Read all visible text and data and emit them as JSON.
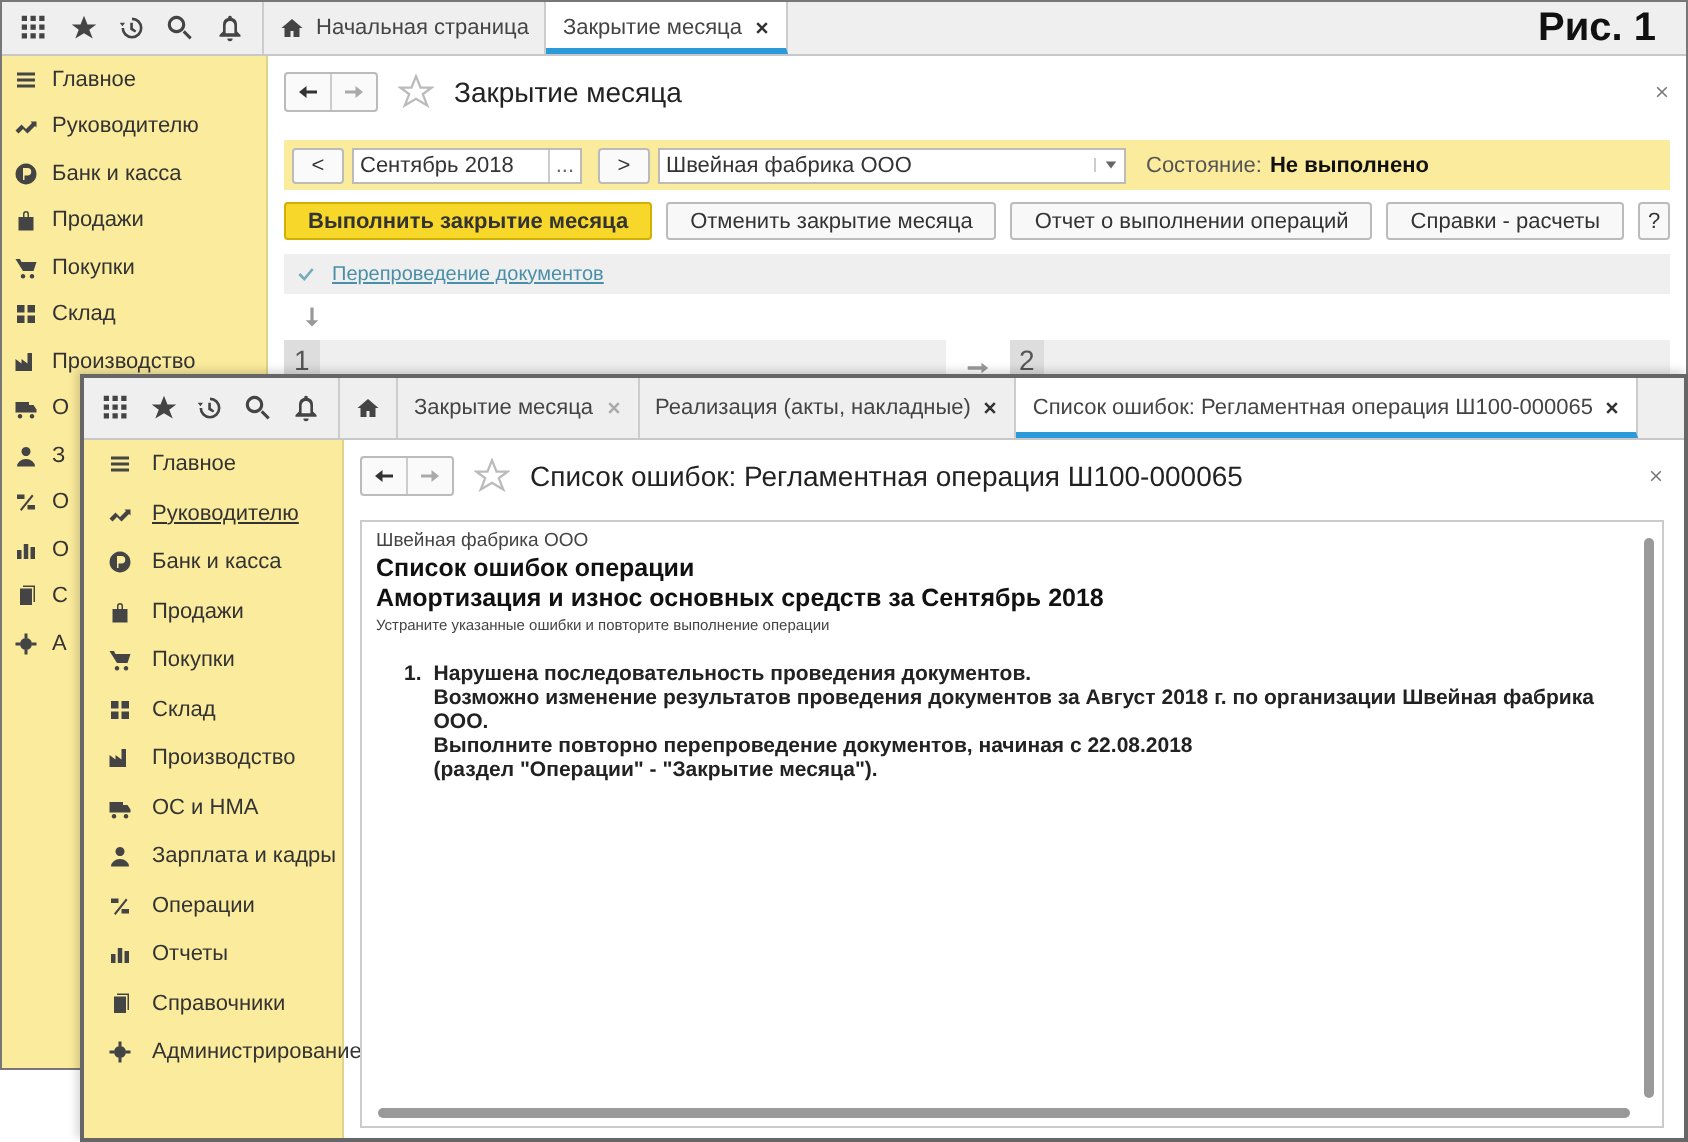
{
  "figure_label": "Рис. 1",
  "back_window": {
    "tabs": [
      {
        "label": "Начальная страница",
        "kind": "home",
        "selected": false
      },
      {
        "label": "Закрытие месяца",
        "kind": "page",
        "selected": true
      }
    ],
    "sidebar": {
      "items": [
        {
          "label": "Главное"
        },
        {
          "label": "Руководителю"
        },
        {
          "label": "Банк и касса"
        },
        {
          "label": "Продажи"
        },
        {
          "label": "Покупки"
        },
        {
          "label": "Склад"
        },
        {
          "label": "Производство"
        },
        {
          "label": "О"
        },
        {
          "label": "З"
        },
        {
          "label": "О"
        },
        {
          "label": "О"
        },
        {
          "label": "С"
        },
        {
          "label": "А"
        }
      ]
    },
    "title": "Закрытие месяца",
    "period": {
      "prev": "<",
      "value": "Сентябрь 2018",
      "picker": "...",
      "next": ">"
    },
    "organization": {
      "value": "Швейная фабрика ООО"
    },
    "status": {
      "label": "Состояние:",
      "value": "Не выполнено"
    },
    "buttons": [
      {
        "label": "Выполнить закрытие месяца",
        "kind": "primary"
      },
      {
        "label": "Отменить закрытие месяца",
        "kind": "normal"
      },
      {
        "label": "Отчет о выполнении операций",
        "kind": "normal"
      },
      {
        "label": "Справки - расчеты",
        "kind": "normal"
      },
      {
        "label": "?",
        "kind": "help"
      }
    ],
    "step_link": {
      "label": "Перепроведение документов",
      "done": true
    },
    "steps": [
      "1",
      "2"
    ]
  },
  "front_window": {
    "tabs": [
      {
        "kind": "home",
        "selected": false
      },
      {
        "label": "Закрытие месяца",
        "kind": "page",
        "selected": false
      },
      {
        "label": "Реализация (акты, накладные)",
        "kind": "page",
        "selected": false
      },
      {
        "label": "Список ошибок: Регламентная операция Ш100-000065",
        "kind": "page",
        "selected": true
      }
    ],
    "sidebar": {
      "items": [
        {
          "label": "Главное",
          "hovered": false
        },
        {
          "label": "Руководителю",
          "hovered": true
        },
        {
          "label": "Банк и касса",
          "hovered": false
        },
        {
          "label": "Продажи",
          "hovered": false
        },
        {
          "label": "Покупки",
          "hovered": false
        },
        {
          "label": "Склад",
          "hovered": false
        },
        {
          "label": "Производство",
          "hovered": false
        },
        {
          "label": "ОС и НМА",
          "hovered": false
        },
        {
          "label": "Зарплата и кадры",
          "hovered": false
        },
        {
          "label": "Операции",
          "hovered": false
        },
        {
          "label": "Отчеты",
          "hovered": false
        },
        {
          "label": "Справочники",
          "hovered": false
        },
        {
          "label": "Администрирование",
          "hovered": false
        }
      ]
    },
    "title": "Список ошибок: Регламентная операция Ш100-000065",
    "report": {
      "organization": "Швейная фабрика ООО",
      "heading": "Список ошибок операции",
      "subheading": "Амортизация и износ основных средств за Сентябрь 2018",
      "hint": "Устраните указанные ошибки и повторите выполнение операции",
      "errors": [
        {
          "number": "1.",
          "lines": [
            "Нарушена последовательность проведения документов.",
            "Возможно изменение результатов проведения документов за Август 2018 г. по организации Швейная фабрика ООО.",
            "Выполните повторно перепроведение документов, начиная с 22.08.2018",
            "(раздел \"Операции\" - \"Закрытие месяца\")."
          ]
        }
      ]
    }
  }
}
